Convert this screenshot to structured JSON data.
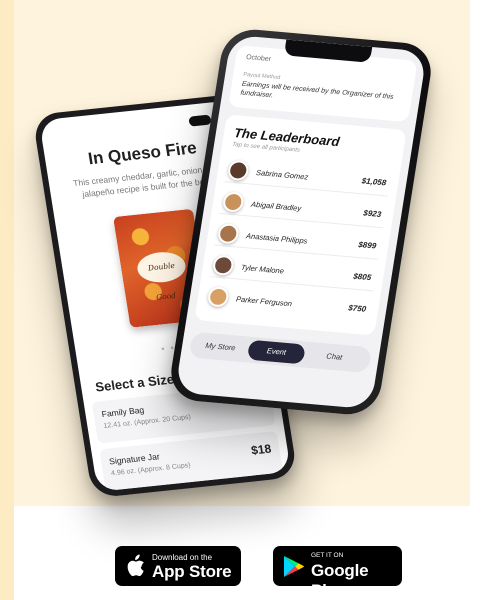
{
  "product_screen": {
    "title": "In Queso Fire",
    "description": "This creamy cheddar, garlic, onion and jalapeño recipe is built for the bold.",
    "bag_label": "Double Good",
    "carousel_dots": "● ● ●",
    "size_heading": "Select a Size",
    "sizes": [
      {
        "name": "Family Bag",
        "detail": "12.41 oz. (Approx. 20 Cups)",
        "price": ""
      },
      {
        "name": "Signature Jar",
        "detail": "4.96 oz. (Approx. 8 Cups)",
        "price": "$18"
      }
    ]
  },
  "leaderboard_screen": {
    "month": "October",
    "payout_label": "Payout Method",
    "payout_text": "Earnings will be received by the Organizer of this fundraiser.",
    "title": "The Leaderboard",
    "subtitle": "Tap to see all participants",
    "participants": [
      {
        "name": "Sabrina Gomez",
        "amount": "$1,058",
        "color": "#5a3a2a"
      },
      {
        "name": "Abigail Bradley",
        "amount": "$923",
        "color": "#c9925a"
      },
      {
        "name": "Anastasia Philipps",
        "amount": "$899",
        "color": "#a8744c"
      },
      {
        "name": "Tyler Malone",
        "amount": "$805",
        "color": "#6b4a3a"
      },
      {
        "name": "Parker Ferguson",
        "amount": "$750",
        "color": "#d9a066"
      }
    ],
    "tabs": [
      {
        "label": "My Store",
        "active": false
      },
      {
        "label": "Event",
        "active": true
      },
      {
        "label": "Chat",
        "active": false
      }
    ]
  },
  "badges": {
    "apple": {
      "small": "Download on the",
      "big": "App Store",
      "icon": "apple-logo-icon"
    },
    "google": {
      "small": "GET IT ON",
      "big": "Google Play",
      "icon": "google-play-logo-icon"
    }
  },
  "colors": {
    "background": "#fef3dc",
    "active_tab": "#24243a"
  }
}
